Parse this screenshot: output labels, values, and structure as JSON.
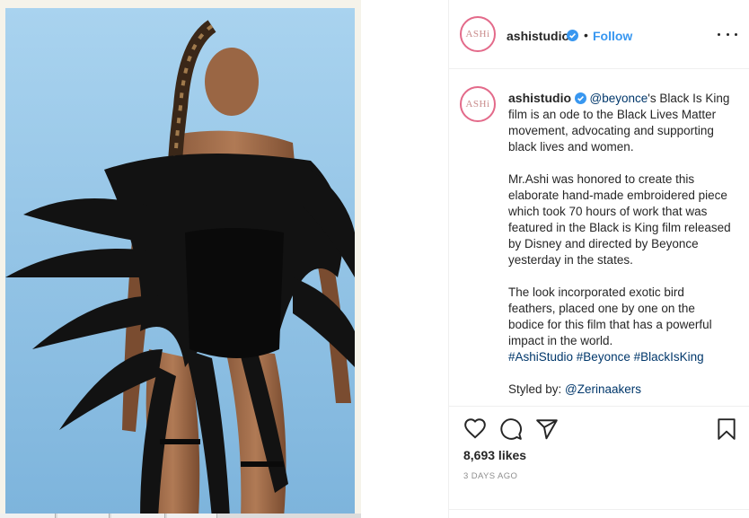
{
  "post": {
    "username": "ashistudio",
    "avatar_text": "ASHi",
    "follow_label": "Follow",
    "separator": "•"
  },
  "caption": {
    "username": "ashistudio",
    "mention": "@beyonce",
    "line1": "'s Black Is King film is an ode to the Black Lives Matter movement, advocating and supporting black lives and women.",
    "para2": "Mr.Ashi was honored to create this elaborate hand-made embroidered piece which took 70 hours of work that was featured in the Black is King film released by Disney and directed by Beyonce yesterday in the states.",
    "para3": "The look incorporated exotic bird feathers, placed one by one on the bodice for this film that has a powerful impact in the world.",
    "hashtags": "#AshiStudio #Beyonce #BlackIsKing",
    "styled_label": "Styled by: ",
    "styled_handle": "@Zerinaakers"
  },
  "stats": {
    "likes": "8,693 likes",
    "time_ago": "3 DAYS AGO"
  },
  "colors": {
    "link": "#00376b",
    "follow": "#3897f0",
    "ring": "#e36a8a",
    "sky": "#8ec3e6"
  },
  "icons": [
    "heart-icon",
    "comment-icon",
    "share-icon",
    "bookmark-icon",
    "verified-icon",
    "more-icon"
  ]
}
